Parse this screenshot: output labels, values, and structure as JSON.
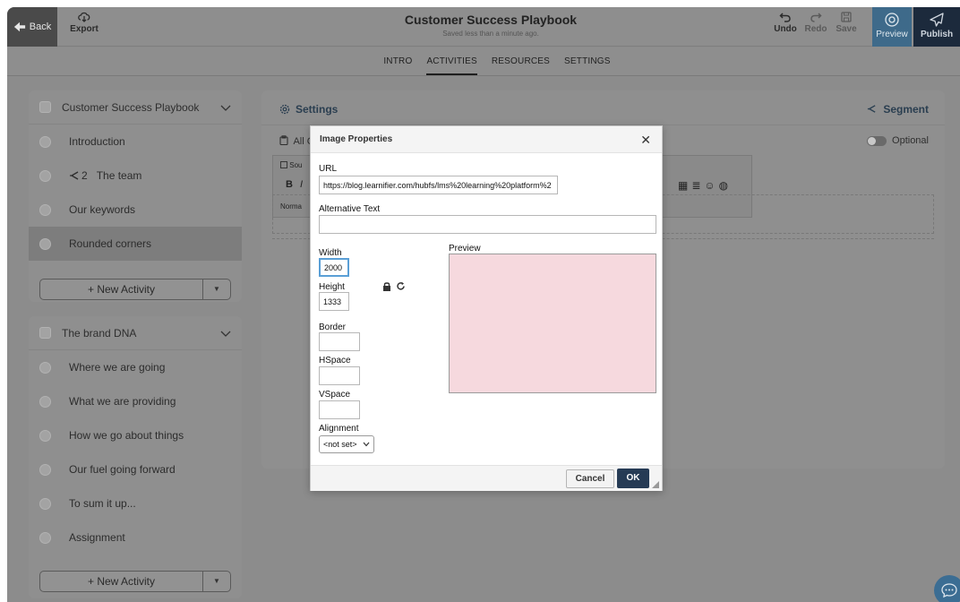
{
  "topbar": {
    "back_label": "Back",
    "export_label": "Export",
    "title": "Customer Success Playbook",
    "save_status": "Saved less than a minute ago.",
    "undo_label": "Undo",
    "redo_label": "Redo",
    "save_label": "Save",
    "preview_label": "Preview",
    "publish_label": "Publish"
  },
  "tabs": [
    {
      "label": "INTRO"
    },
    {
      "label": "ACTIVITIES",
      "active": true
    },
    {
      "label": "RESOURCES"
    },
    {
      "label": "SETTINGS"
    }
  ],
  "sidebar": {
    "sections": [
      {
        "title": "Customer Success Playbook",
        "items": [
          {
            "label": "Introduction"
          },
          {
            "label": "The team",
            "prefix": "2"
          },
          {
            "label": "Our keywords"
          },
          {
            "label": "Rounded corners",
            "selected": true
          }
        ],
        "new_activity_label": "+ New Activity"
      },
      {
        "title": "The brand DNA",
        "items": [
          {
            "label": "Where we are going"
          },
          {
            "label": "What we are providing"
          },
          {
            "label": "How we go about things"
          },
          {
            "label": "Our fuel going forward"
          },
          {
            "label": "To sum it up..."
          },
          {
            "label": "Assignment"
          }
        ],
        "new_activity_label": "+ New Activity"
      }
    ]
  },
  "main": {
    "settings_label": "Settings",
    "segment_label": "Segment",
    "all_label": "All C",
    "optional_label": "Optional",
    "editor": {
      "source_label": "Sou",
      "format_label": "Norma"
    }
  },
  "modal": {
    "title": "Image Properties",
    "url_label": "URL",
    "url_value": "https://blog.learnifier.com/hubfs/lms%20learning%20platform%2",
    "alt_label": "Alternative Text",
    "alt_value": "",
    "width_label": "Width",
    "width_value": "2000",
    "height_label": "Height",
    "height_value": "1333",
    "border_label": "Border",
    "border_value": "",
    "hspace_label": "HSpace",
    "hspace_value": "",
    "vspace_label": "VSpace",
    "vspace_value": "",
    "alignment_label": "Alignment",
    "alignment_value": "<not set>",
    "preview_label": "Preview",
    "cancel_label": "Cancel",
    "ok_label": "OK"
  },
  "colors": {
    "ok_button": "#263b55",
    "preview_fill": "#f6d9de",
    "publish_bg": "#1c2a3c",
    "preview_bg": "#3e6a8a"
  }
}
